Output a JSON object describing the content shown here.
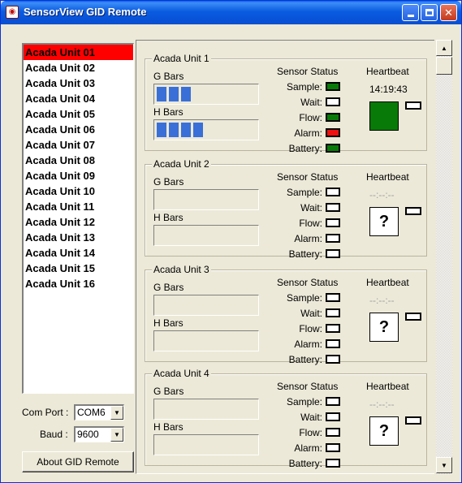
{
  "window": {
    "title": "SensorView GID Remote"
  },
  "unit_list": [
    "Acada Unit 01",
    "Acada Unit 02",
    "Acada Unit 03",
    "Acada Unit 04",
    "Acada Unit 05",
    "Acada Unit 06",
    "Acada Unit 07",
    "Acada Unit 08",
    "Acada Unit 09",
    "Acada Unit 10",
    "Acada Unit 11",
    "Acada Unit 12",
    "Acada Unit 13",
    "Acada Unit 14",
    "Acada Unit 15",
    "Acada Unit 16"
  ],
  "selected_unit": "Acada Unit 01",
  "com_port": {
    "label": "Com Port :",
    "value": "COM6"
  },
  "baud": {
    "label": "Baud :",
    "value": "9600"
  },
  "about_button": "About GID Remote",
  "labels": {
    "g_bars": "G Bars",
    "h_bars": "H Bars",
    "sensor_status": "Sensor Status",
    "heartbeat": "Heartbeat",
    "sample": "Sample:",
    "wait": "Wait:",
    "flow": "Flow:",
    "alarm": "Alarm:",
    "battery": "Battery:"
  },
  "units": [
    {
      "name": "Acada Unit 1",
      "g_bars": 3,
      "h_bars": 4,
      "status": {
        "sample": "green",
        "wait": "off",
        "flow": "green",
        "alarm": "red",
        "battery": "green"
      },
      "heartbeat_time": "14:19:43",
      "heartbeat_symbol": "",
      "heartbeat_state": "on"
    },
    {
      "name": "Acada Unit 2",
      "g_bars": 0,
      "h_bars": 0,
      "status": {
        "sample": "off",
        "wait": "off",
        "flow": "off",
        "alarm": "off",
        "battery": "off"
      },
      "heartbeat_time": "--:--:--",
      "heartbeat_symbol": "?",
      "heartbeat_state": "unknown"
    },
    {
      "name": "Acada Unit 3",
      "g_bars": 0,
      "h_bars": 0,
      "status": {
        "sample": "off",
        "wait": "off",
        "flow": "off",
        "alarm": "off",
        "battery": "off"
      },
      "heartbeat_time": "--:--:--",
      "heartbeat_symbol": "?",
      "heartbeat_state": "unknown"
    },
    {
      "name": "Acada Unit 4",
      "g_bars": 0,
      "h_bars": 0,
      "status": {
        "sample": "off",
        "wait": "off",
        "flow": "off",
        "alarm": "off",
        "battery": "off"
      },
      "heartbeat_time": "--:--:--",
      "heartbeat_symbol": "?",
      "heartbeat_state": "unknown"
    }
  ],
  "icons": {
    "app": "sensor-app-icon",
    "minimize": "minimize-icon",
    "maximize": "maximize-icon",
    "close": "close-icon",
    "dropdown": "chevron-down-icon",
    "scroll_up": "scroll-up-arrow-icon",
    "scroll_down": "scroll-down-arrow-icon"
  },
  "colors": {
    "selected_row": "#ff0000",
    "led_green": "#087a08",
    "led_red": "#f01010",
    "bar_blue": "#3a6fd8"
  }
}
